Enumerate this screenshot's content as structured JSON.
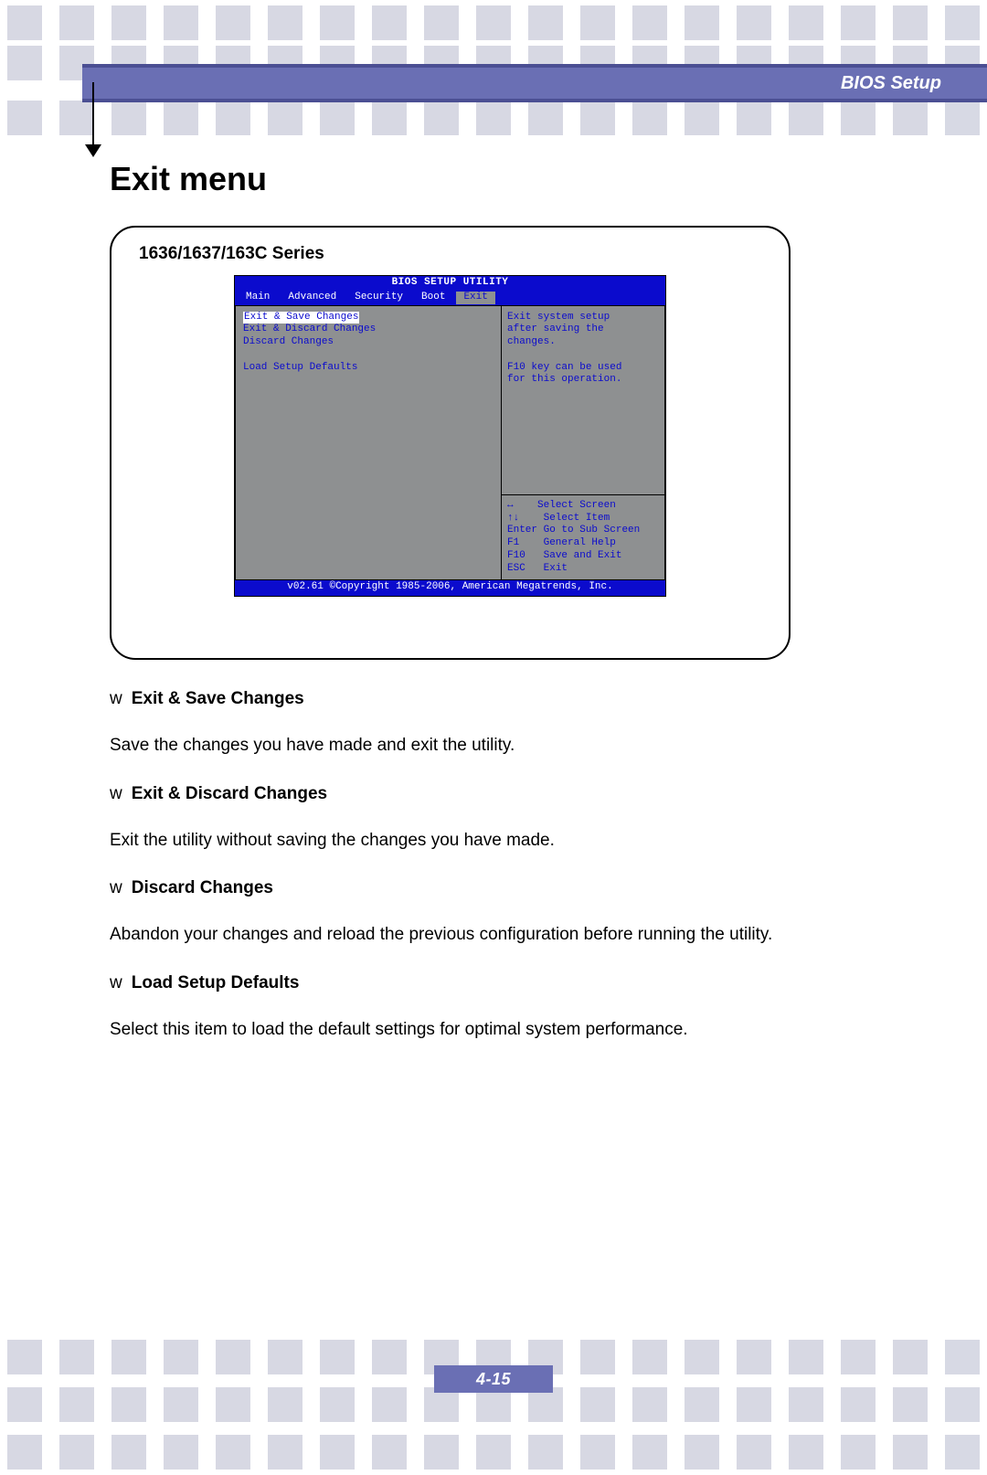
{
  "header": {
    "title": "BIOS Setup"
  },
  "page": {
    "title": "Exit menu",
    "frame_title": "1636/1637/163C Series",
    "page_number": "4-15"
  },
  "bios": {
    "utility_title": "BIOS SETUP UTILITY",
    "tabs": [
      "Main",
      "Advanced",
      "Security",
      "Boot",
      "Exit"
    ],
    "active_tab_index": 4,
    "options": [
      "Exit & Save Changes",
      "Exit & Discard Changes",
      "Discard Changes",
      "",
      "Load Setup Defaults"
    ],
    "selected_option_index": 0,
    "help_top": [
      "Exit system setup",
      "after saving the",
      "changes.",
      "",
      "F10 key can be used",
      "for this operation."
    ],
    "key_hints": [
      {
        "key": "↔",
        "action": "Select Screen"
      },
      {
        "key": "↑↓",
        "action": "Select Item"
      },
      {
        "key": "Enter",
        "action": "Go to Sub Screen"
      },
      {
        "key": "F1",
        "action": "General Help"
      },
      {
        "key": "F10",
        "action": "Save and Exit"
      },
      {
        "key": "ESC",
        "action": "Exit"
      }
    ],
    "footer": "v02.61 ©Copyright 1985-2006, American Megatrends, Inc."
  },
  "descriptions": [
    {
      "title": "Exit & Save Changes",
      "body": "Save the changes you have made and exit the utility."
    },
    {
      "title": "Exit & Discard Changes",
      "body": "Exit the utility without saving the changes you have made."
    },
    {
      "title": "Discard Changes",
      "body": "Abandon your changes and reload the previous configuration before running the utility."
    },
    {
      "title": "Load Setup Defaults",
      "body": "Select this item to load the default settings for optimal system performance."
    }
  ]
}
